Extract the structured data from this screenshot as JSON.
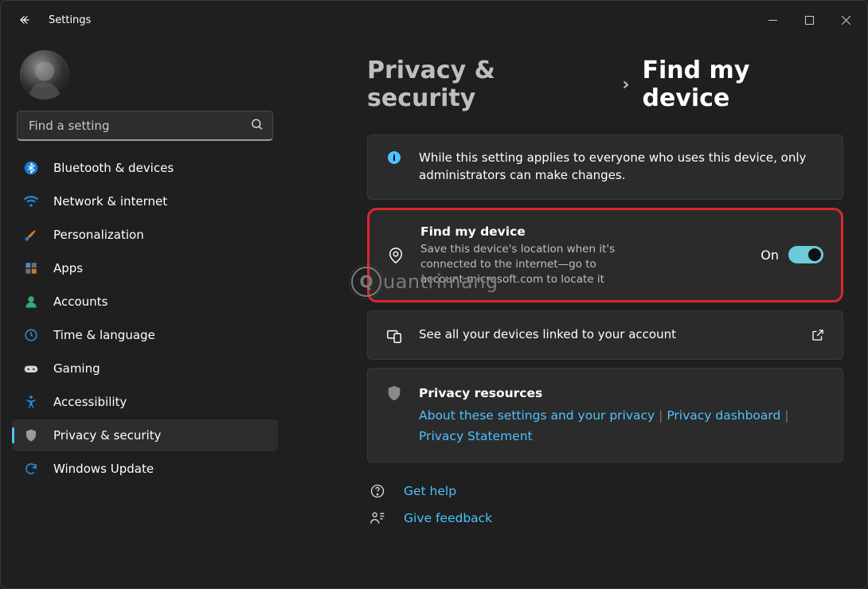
{
  "window": {
    "title": "Settings"
  },
  "search": {
    "placeholder": "Find a setting"
  },
  "sidebar": {
    "items": [
      {
        "label": "Bluetooth & devices",
        "icon": "bluetooth"
      },
      {
        "label": "Network & internet",
        "icon": "wifi"
      },
      {
        "label": "Personalization",
        "icon": "brush"
      },
      {
        "label": "Apps",
        "icon": "apps"
      },
      {
        "label": "Accounts",
        "icon": "person"
      },
      {
        "label": "Time & language",
        "icon": "clock-globe"
      },
      {
        "label": "Gaming",
        "icon": "gamepad"
      },
      {
        "label": "Accessibility",
        "icon": "accessibility"
      },
      {
        "label": "Privacy & security",
        "icon": "shield"
      },
      {
        "label": "Windows Update",
        "icon": "update"
      }
    ]
  },
  "breadcrumb": {
    "parent": "Privacy & security",
    "current": "Find my device"
  },
  "info_banner": "While this setting applies to everyone who uses this device, only administrators can make changes.",
  "setting": {
    "title": "Find my device",
    "description": "Save this device's location when it's connected to the internet—go to account.microsoft.com to locate it",
    "state_label": "On"
  },
  "linked_devices_label": "See all your devices linked to your account",
  "resources": {
    "title": "Privacy resources",
    "links": [
      "About these settings and your privacy",
      "Privacy dashboard",
      "Privacy Statement"
    ]
  },
  "footer": {
    "help": "Get help",
    "feedback": "Give feedback"
  },
  "watermark": "uantrimang"
}
